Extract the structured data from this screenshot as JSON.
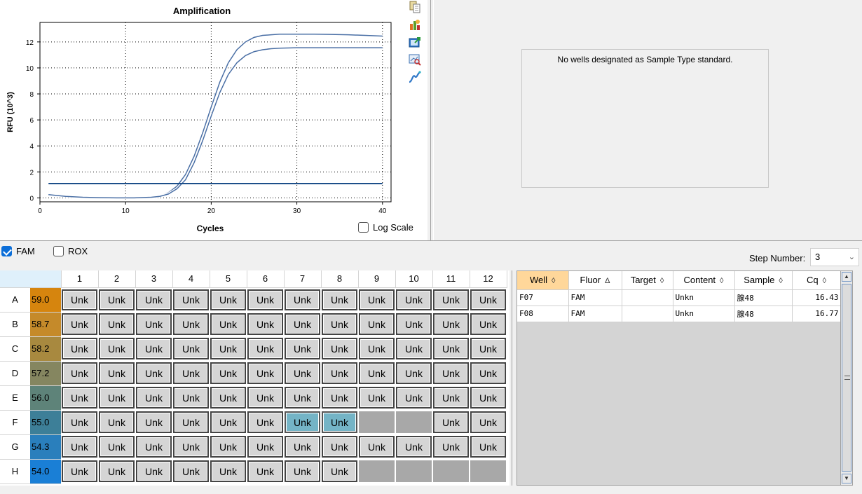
{
  "chart": {
    "title": "Amplification",
    "xlabel": "Cycles",
    "ylabel": "RFU (10^3)",
    "log_scale_label": "Log Scale",
    "log_scale_checked": false
  },
  "chart_data": {
    "type": "line",
    "title": "Amplification",
    "xlabel": "Cycles",
    "ylabel": "RFU (10^3)",
    "xlim": [
      0,
      41
    ],
    "ylim": [
      -0.3,
      13.5
    ],
    "xticks": [
      0,
      10,
      20,
      30,
      40
    ],
    "yticks": [
      0,
      2,
      4,
      6,
      8,
      10,
      12
    ],
    "grid": true,
    "colors": {
      "curve": "#4a6fa5",
      "threshold": "#1d4f8a"
    },
    "threshold": 1.1,
    "series": [
      {
        "x": [
          1,
          3,
          5,
          7,
          9,
          11,
          13,
          14,
          15,
          16,
          17,
          18,
          19,
          20,
          21,
          22,
          23,
          24,
          25,
          26,
          27,
          28,
          30,
          32,
          34,
          36,
          38,
          40
        ],
        "values": [
          0.25,
          0.12,
          0.05,
          0.02,
          0.0,
          0.0,
          0.05,
          0.15,
          0.4,
          0.9,
          1.8,
          3.2,
          5.0,
          7.0,
          8.9,
          10.4,
          11.4,
          12.0,
          12.35,
          12.5,
          12.55,
          12.6,
          12.6,
          12.6,
          12.58,
          12.55,
          12.5,
          12.45
        ]
      },
      {
        "x": [
          1,
          3,
          5,
          7,
          9,
          11,
          13,
          14,
          15,
          16,
          17,
          18,
          19,
          20,
          21,
          22,
          23,
          24,
          25,
          26,
          27,
          28,
          30,
          32,
          34,
          36,
          38,
          40
        ],
        "values": [
          0.25,
          0.12,
          0.05,
          0.02,
          0.0,
          0.0,
          0.05,
          0.12,
          0.3,
          0.7,
          1.4,
          2.7,
          4.4,
          6.3,
          8.1,
          9.5,
          10.4,
          10.95,
          11.25,
          11.4,
          11.48,
          11.52,
          11.55,
          11.55,
          11.55,
          11.55,
          11.55,
          11.55
        ]
      }
    ]
  },
  "standard_curve": {
    "message": "No wells designated as Sample Type standard."
  },
  "fluor_bar": {
    "fam_label": "FAM",
    "fam_checked": true,
    "rox_label": "ROX",
    "rox_checked": false,
    "step_label": "Step Number:",
    "step_value": "3"
  },
  "plate": {
    "columns": [
      "1",
      "2",
      "3",
      "4",
      "5",
      "6",
      "7",
      "8",
      "9",
      "10",
      "11",
      "12"
    ],
    "rows": [
      {
        "label": "A",
        "temp": "59.0",
        "color": "#d6850e",
        "wells": [
          "Unk",
          "Unk",
          "Unk",
          "Unk",
          "Unk",
          "Unk",
          "Unk",
          "Unk",
          "Unk",
          "Unk",
          "Unk",
          "Unk"
        ]
      },
      {
        "label": "B",
        "temp": "58.7",
        "color": "#c58a2a",
        "wells": [
          "Unk",
          "Unk",
          "Unk",
          "Unk",
          "Unk",
          "Unk",
          "Unk",
          "Unk",
          "Unk",
          "Unk",
          "Unk",
          "Unk"
        ]
      },
      {
        "label": "C",
        "temp": "58.2",
        "color": "#a8893f",
        "wells": [
          "Unk",
          "Unk",
          "Unk",
          "Unk",
          "Unk",
          "Unk",
          "Unk",
          "Unk",
          "Unk",
          "Unk",
          "Unk",
          "Unk"
        ]
      },
      {
        "label": "D",
        "temp": "57.2",
        "color": "#858660",
        "wells": [
          "Unk",
          "Unk",
          "Unk",
          "Unk",
          "Unk",
          "Unk",
          "Unk",
          "Unk",
          "Unk",
          "Unk",
          "Unk",
          "Unk"
        ]
      },
      {
        "label": "E",
        "temp": "56.0",
        "color": "#5e8379",
        "wells": [
          "Unk",
          "Unk",
          "Unk",
          "Unk",
          "Unk",
          "Unk",
          "Unk",
          "Unk",
          "Unk",
          "Unk",
          "Unk",
          "Unk"
        ]
      },
      {
        "label": "F",
        "temp": "55.0",
        "color": "#3d7f98",
        "wells": [
          "Unk",
          "Unk",
          "Unk",
          "Unk",
          "Unk",
          "Unk",
          "Unk*",
          "Unk*",
          "",
          "",
          "Unk",
          "Unk"
        ]
      },
      {
        "label": "G",
        "temp": "54.3",
        "color": "#2a7fbc",
        "wells": [
          "Unk",
          "Unk",
          "Unk",
          "Unk",
          "Unk",
          "Unk",
          "Unk",
          "Unk",
          "Unk",
          "Unk",
          "Unk",
          "Unk"
        ]
      },
      {
        "label": "H",
        "temp": "54.0",
        "color": "#1a7fd6",
        "wells": [
          "Unk",
          "Unk",
          "Unk",
          "Unk",
          "Unk",
          "Unk",
          "Unk",
          "Unk",
          "",
          "",
          "",
          ""
        ]
      }
    ]
  },
  "results": {
    "headers": [
      {
        "label": "Well",
        "sort": "◊",
        "active": true
      },
      {
        "label": "Fluor",
        "sort": "Δ",
        "active": false
      },
      {
        "label": "Target",
        "sort": "◊",
        "active": false
      },
      {
        "label": "Content",
        "sort": "◊",
        "active": false
      },
      {
        "label": "Sample",
        "sort": "◊",
        "active": false
      },
      {
        "label": "Cq",
        "sort": "◊",
        "active": false
      }
    ],
    "rows": [
      [
        "F07",
        "FAM",
        "",
        "Unkn",
        "腺48",
        "16.43"
      ],
      [
        "F08",
        "FAM",
        "",
        "Unkn",
        "腺48",
        "16.77"
      ]
    ]
  }
}
